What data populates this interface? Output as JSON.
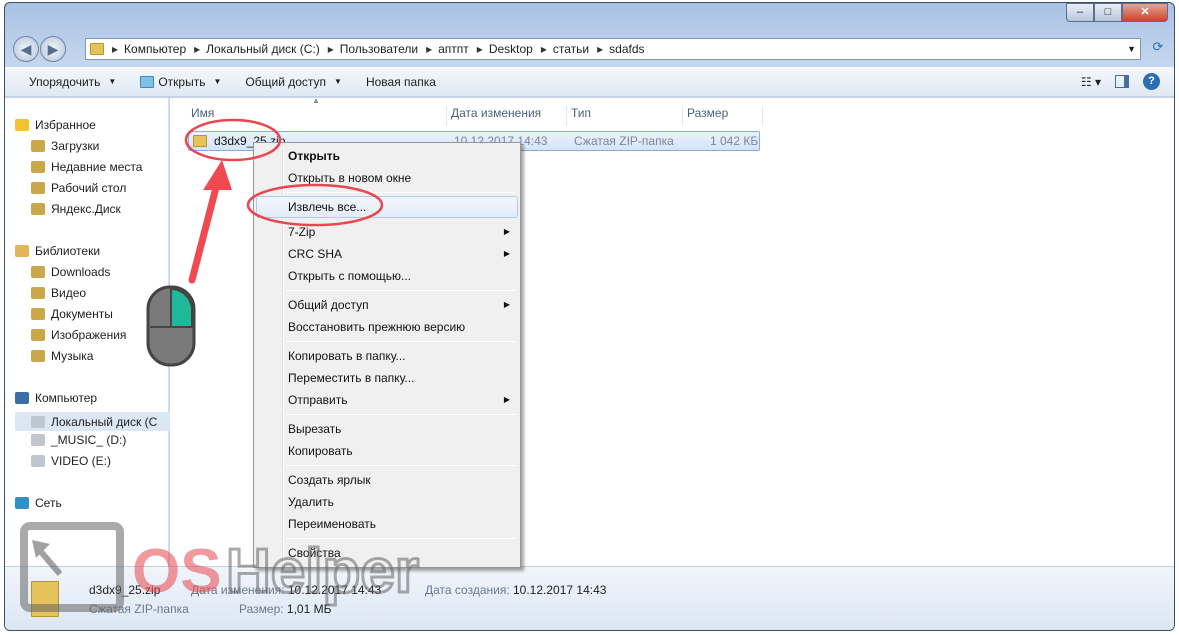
{
  "window": {
    "minimize": "–",
    "maximize": "□",
    "close": "✕"
  },
  "address": {
    "crumbs": [
      "Компьютер",
      "Локальный диск (C:)",
      "Пользователи",
      "аптпт",
      "Desktop",
      "статьи",
      "sdafds"
    ]
  },
  "toolbar": {
    "organize": "Упорядочить",
    "open": "Открыть",
    "share": "Общий доступ",
    "new_folder": "Новая папка"
  },
  "sidebar": {
    "favorites": {
      "label": "Избранное",
      "items": [
        "Загрузки",
        "Недавние места",
        "Рабочий стол",
        "Яндекс.Диск"
      ]
    },
    "libraries": {
      "label": "Библиотеки",
      "items": [
        "Downloads",
        "Видео",
        "Документы",
        "Изображения",
        "Музыка"
      ]
    },
    "computer": {
      "label": "Компьютер",
      "items": [
        "Локальный диск (C",
        "_MUSIC_ (D:)",
        "VIDEO (E:)"
      ]
    },
    "network": {
      "label": "Сеть"
    }
  },
  "columns": [
    "Имя",
    "Дата изменения",
    "Тип",
    "Размер"
  ],
  "file": {
    "name": "d3dx9_25.zip",
    "date": "10.12.2017 14:43",
    "type": "Сжатая ZIP-папка",
    "size": "1 042 КБ"
  },
  "context_menu": [
    [
      {
        "label": "Открыть",
        "bold": true
      },
      {
        "label": "Открыть в новом окне"
      }
    ],
    [
      {
        "label": "Извлечь все...",
        "highlighted": true
      },
      {
        "label": "7-Zip",
        "submenu": true
      },
      {
        "label": "CRC SHA",
        "submenu": true
      },
      {
        "label": "Открыть с помощью..."
      }
    ],
    [
      {
        "label": "Общий доступ",
        "submenu": true
      },
      {
        "label": "Восстановить прежнюю версию"
      }
    ],
    [
      {
        "label": "Копировать в папку..."
      },
      {
        "label": "Переместить в папку..."
      },
      {
        "label": "Отправить",
        "submenu": true
      }
    ],
    [
      {
        "label": "Вырезать"
      },
      {
        "label": "Копировать"
      }
    ],
    [
      {
        "label": "Создать ярлык"
      },
      {
        "label": "Удалить"
      },
      {
        "label": "Переименовать"
      }
    ],
    [
      {
        "label": "Свойства"
      }
    ]
  ],
  "status": {
    "name": "d3dx9_25.zip",
    "type": "Сжатая ZIP-папка",
    "modified_label": "Дата изменения:",
    "modified": "10.12.2017 14:43",
    "created_label": "Дата создания:",
    "created": "10.12.2017 14:43",
    "size_label": "Размер:",
    "size": "1,01 МБ"
  },
  "watermark": "OS Helper",
  "colors": {
    "annotation": "#e8474f",
    "selection": "#d3e4fb",
    "mouse_button": "#1fb89a"
  }
}
